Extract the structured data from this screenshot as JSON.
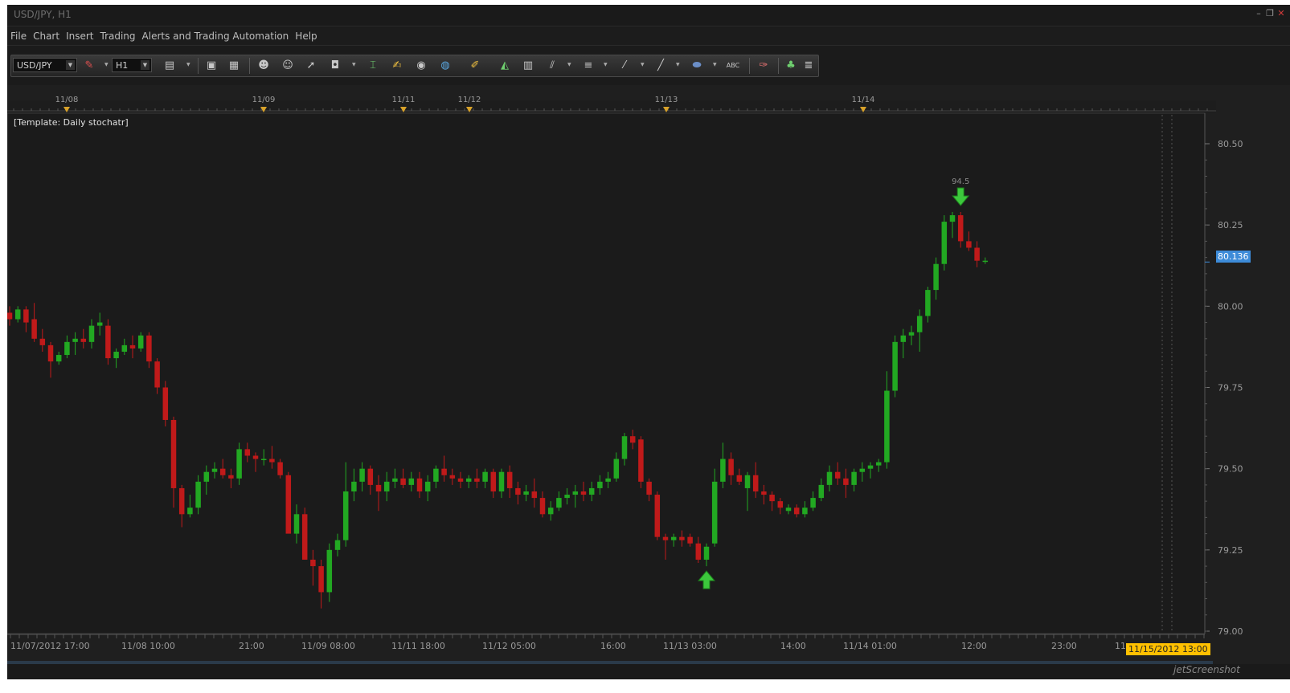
{
  "window": {
    "title": "USD/JPY, H1",
    "controls": [
      "–",
      "❐",
      "✕"
    ]
  },
  "menu": [
    "File",
    "Chart",
    "Insert",
    "Trading",
    "Alerts and Trading Automation",
    "Help"
  ],
  "toolbar": {
    "symbol": "USD/JPY",
    "timeframe": "H1",
    "icons": [
      "chart-type-icon",
      "bar-icon",
      "candle-icon",
      "user-icon",
      "user-settings-icon",
      "cursor-icon",
      "zoom-icon",
      "crosshair-icon",
      "note-icon",
      "eye-icon",
      "globe-icon",
      "ruler-icon",
      "chart-icon",
      "window-icon",
      "fibonacci-icon",
      "lines-icon",
      "pen-icon",
      "line-icon",
      "ellipse-icon",
      "text-icon",
      "eraser-icon",
      "tree-icon",
      "menu-icon"
    ]
  },
  "chart_data": {
    "type": "candlestick",
    "symbol": "USD/JPY",
    "timeframe": "H1",
    "template_label": "[Template: Daily stochatr]",
    "ylim": [
      79.0,
      80.5
    ],
    "y_ticks": [
      "80.50",
      "80.25",
      "80.00",
      "79.75",
      "79.50",
      "79.25",
      "79.00"
    ],
    "top_date_labels": [
      "11/08",
      "11/09",
      "11/11",
      "11/12",
      "11/13",
      "11/14"
    ],
    "x_labels": [
      "11/07/2012 17:00",
      "11/08 10:00",
      "21:00",
      "11/09 08:00",
      "11/11 18:00",
      "11/12 05:00",
      "16:00",
      "11/13 03:00",
      "14:00",
      "11/14 01:00",
      "12:00",
      "23:00",
      "11"
    ],
    "current_price": "80.136",
    "current_time": "11/15/2012 13:00",
    "signal_down_label": "94.5",
    "colors": {
      "up": "#22a822",
      "down": "#c01a1a",
      "background": "#1b1b1b",
      "grid_text": "#9a9a9a",
      "price_tag": "#3d8bd8",
      "time_tag": "#ffc000"
    },
    "candles": [
      [
        79.98,
        80.0,
        79.94,
        79.96
      ],
      [
        79.96,
        80.0,
        79.95,
        79.99
      ],
      [
        79.99,
        80.0,
        79.92,
        79.95
      ],
      [
        79.96,
        80.01,
        79.89,
        79.9
      ],
      [
        79.9,
        79.93,
        79.86,
        79.88
      ],
      [
        79.88,
        79.89,
        79.78,
        79.83
      ],
      [
        79.83,
        79.86,
        79.82,
        79.85
      ],
      [
        79.85,
        79.91,
        79.84,
        79.89
      ],
      [
        79.89,
        79.92,
        79.85,
        79.9
      ],
      [
        79.9,
        79.93,
        79.87,
        79.89
      ],
      [
        79.89,
        79.96,
        79.87,
        79.94
      ],
      [
        79.94,
        79.98,
        79.91,
        79.95
      ],
      [
        79.94,
        79.96,
        79.82,
        79.84
      ],
      [
        79.84,
        79.87,
        79.81,
        79.86
      ],
      [
        79.86,
        79.9,
        79.85,
        79.88
      ],
      [
        79.88,
        79.91,
        79.84,
        79.87
      ],
      [
        79.87,
        79.92,
        79.86,
        79.91
      ],
      [
        79.91,
        79.92,
        79.81,
        79.83
      ],
      [
        79.83,
        79.84,
        79.73,
        79.75
      ],
      [
        79.75,
        79.77,
        79.63,
        79.65
      ],
      [
        79.65,
        79.66,
        79.38,
        79.44
      ],
      [
        79.44,
        79.45,
        79.32,
        79.36
      ],
      [
        79.36,
        79.42,
        79.35,
        79.38
      ],
      [
        79.38,
        79.48,
        79.36,
        79.46
      ],
      [
        79.46,
        79.51,
        79.42,
        79.49
      ],
      [
        79.49,
        79.52,
        79.47,
        79.5
      ],
      [
        79.5,
        79.53,
        79.47,
        79.48
      ],
      [
        79.48,
        79.5,
        79.44,
        79.47
      ],
      [
        79.47,
        79.58,
        79.45,
        79.56
      ],
      [
        79.56,
        79.58,
        79.52,
        79.54
      ],
      [
        79.54,
        79.55,
        79.49,
        79.53
      ],
      [
        79.53,
        79.56,
        79.51,
        79.53
      ],
      [
        79.53,
        79.57,
        79.5,
        79.52
      ],
      [
        79.52,
        79.53,
        79.47,
        79.48
      ],
      [
        79.48,
        79.49,
        79.32,
        79.3
      ],
      [
        79.3,
        79.39,
        79.27,
        79.36
      ],
      [
        79.36,
        79.38,
        79.22,
        79.22
      ],
      [
        79.22,
        79.25,
        79.14,
        79.2
      ],
      [
        79.2,
        79.22,
        79.07,
        79.12
      ],
      [
        79.12,
        79.27,
        79.09,
        79.25
      ],
      [
        79.25,
        79.3,
        79.23,
        79.28
      ],
      [
        79.28,
        79.52,
        79.26,
        79.43
      ],
      [
        79.43,
        79.5,
        79.4,
        79.46
      ],
      [
        79.46,
        79.52,
        79.43,
        79.5
      ],
      [
        79.5,
        79.51,
        79.42,
        79.45
      ],
      [
        79.45,
        79.48,
        79.37,
        79.43
      ],
      [
        79.43,
        79.49,
        79.4,
        79.46
      ],
      [
        79.46,
        79.5,
        79.44,
        79.47
      ],
      [
        79.47,
        79.5,
        79.44,
        79.45
      ],
      [
        79.45,
        79.49,
        79.43,
        79.47
      ],
      [
        79.47,
        79.49,
        79.41,
        79.43
      ],
      [
        79.43,
        79.48,
        79.4,
        79.46
      ],
      [
        79.46,
        79.51,
        79.44,
        79.5
      ],
      [
        79.5,
        79.54,
        79.46,
        79.48
      ],
      [
        79.48,
        79.5,
        79.45,
        79.47
      ],
      [
        79.47,
        79.49,
        79.44,
        79.46
      ],
      [
        79.46,
        79.48,
        79.44,
        79.47
      ],
      [
        79.47,
        79.5,
        79.44,
        79.46
      ],
      [
        79.46,
        79.5,
        79.44,
        79.49
      ],
      [
        79.49,
        79.5,
        79.41,
        79.43
      ],
      [
        79.43,
        79.5,
        79.41,
        79.49
      ],
      [
        79.49,
        79.51,
        79.41,
        79.44
      ],
      [
        79.44,
        79.46,
        79.39,
        79.42
      ],
      [
        79.42,
        79.45,
        79.4,
        79.43
      ],
      [
        79.43,
        79.47,
        79.38,
        79.41
      ],
      [
        79.41,
        79.43,
        79.35,
        79.36
      ],
      [
        79.36,
        79.4,
        79.34,
        79.38
      ],
      [
        79.38,
        79.43,
        79.37,
        79.41
      ],
      [
        79.41,
        79.44,
        79.39,
        79.42
      ],
      [
        79.42,
        79.45,
        79.38,
        79.43
      ],
      [
        79.43,
        79.46,
        79.4,
        79.42
      ],
      [
        79.42,
        79.46,
        79.4,
        79.44
      ],
      [
        79.44,
        79.48,
        79.42,
        79.46
      ],
      [
        79.46,
        79.49,
        79.44,
        79.47
      ],
      [
        79.47,
        79.55,
        79.46,
        79.53
      ],
      [
        79.53,
        79.61,
        79.51,
        79.6
      ],
      [
        79.6,
        79.62,
        79.56,
        79.58
      ],
      [
        79.59,
        79.6,
        79.44,
        79.46
      ],
      [
        79.46,
        79.47,
        79.4,
        79.42
      ],
      [
        79.42,
        79.43,
        79.28,
        79.29
      ],
      [
        79.29,
        79.3,
        79.22,
        79.28
      ],
      [
        79.28,
        79.3,
        79.26,
        79.29
      ],
      [
        79.29,
        79.31,
        79.26,
        79.28
      ],
      [
        79.29,
        79.3,
        79.26,
        79.27
      ],
      [
        79.27,
        79.29,
        79.21,
        79.22
      ],
      [
        79.22,
        79.27,
        79.2,
        79.26
      ],
      [
        79.27,
        79.5,
        79.26,
        79.46
      ],
      [
        79.46,
        79.58,
        79.44,
        79.53
      ],
      [
        79.53,
        79.55,
        79.45,
        79.48
      ],
      [
        79.48,
        79.5,
        79.45,
        79.46
      ],
      [
        79.44,
        79.49,
        79.37,
        79.48
      ],
      [
        79.48,
        79.52,
        79.41,
        79.43
      ],
      [
        79.43,
        79.45,
        79.39,
        79.42
      ],
      [
        79.42,
        79.43,
        79.37,
        79.4
      ],
      [
        79.4,
        79.41,
        79.36,
        79.38
      ],
      [
        79.37,
        79.39,
        79.36,
        79.38
      ],
      [
        79.38,
        79.39,
        79.35,
        79.36
      ],
      [
        79.36,
        79.4,
        79.35,
        79.38
      ],
      [
        79.38,
        79.43,
        79.37,
        79.41
      ],
      [
        79.41,
        79.47,
        79.4,
        79.45
      ],
      [
        79.45,
        79.51,
        79.43,
        79.49
      ],
      [
        79.49,
        79.52,
        79.45,
        79.47
      ],
      [
        79.47,
        79.5,
        79.41,
        79.45
      ],
      [
        79.45,
        79.5,
        79.43,
        79.49
      ],
      [
        79.49,
        79.52,
        79.46,
        79.5
      ],
      [
        79.5,
        79.52,
        79.47,
        79.51
      ],
      [
        79.51,
        79.53,
        79.49,
        79.52
      ],
      [
        79.52,
        79.8,
        79.5,
        79.74
      ],
      [
        79.74,
        79.91,
        79.72,
        79.89
      ],
      [
        79.89,
        79.93,
        79.84,
        79.91
      ],
      [
        79.91,
        79.94,
        79.88,
        79.92
      ],
      [
        79.92,
        79.99,
        79.86,
        79.97
      ],
      [
        79.97,
        80.06,
        79.95,
        80.05
      ],
      [
        80.05,
        80.15,
        80.02,
        80.13
      ],
      [
        80.13,
        80.28,
        80.11,
        80.26
      ],
      [
        80.26,
        80.29,
        80.21,
        80.28
      ],
      [
        80.28,
        80.29,
        80.18,
        80.2
      ],
      [
        80.2,
        80.23,
        80.17,
        80.18
      ],
      [
        80.18,
        80.2,
        80.12,
        80.14
      ],
      [
        80.14,
        80.15,
        80.13,
        80.14
      ]
    ],
    "signal_down_index": 116,
    "signal_up_index": 85
  },
  "watermark": "jetScreenshot"
}
